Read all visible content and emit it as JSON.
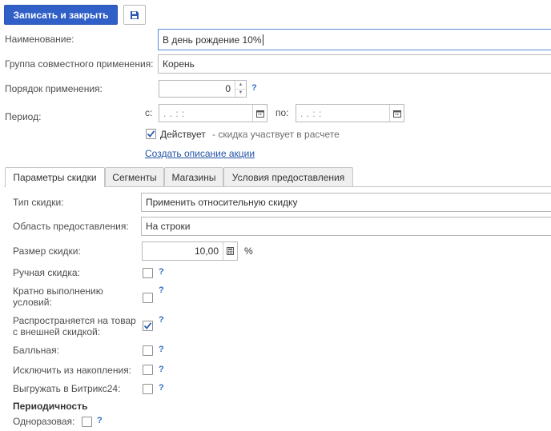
{
  "toolbar": {
    "save_close_label": "Записать и закрыть",
    "save_icon": "floppy-disk-icon"
  },
  "form": {
    "name_label": "Наименование:",
    "name_value": "В день рождение 10%",
    "group_label": "Группа совместного применения:",
    "group_value": "Корень",
    "order_label": "Порядок применения:",
    "order_value": "0",
    "period_label": "Период:",
    "period_from_label": "с:",
    "period_from_value": ".   .       :  :",
    "period_to_label": "по:",
    "period_to_value": ".   .       :  :",
    "active_label": "Действует",
    "active_checked": true,
    "active_hint": "- скидка участвует в расчете",
    "create_description_link": "Создать описание акции"
  },
  "tabs": [
    {
      "label": "Параметры скидки",
      "active": true
    },
    {
      "label": "Сегменты",
      "active": false
    },
    {
      "label": "Магазины",
      "active": false
    },
    {
      "label": "Условия предоставления",
      "active": false
    }
  ],
  "params": {
    "discount_type_label": "Тип скидки:",
    "discount_type_value": "Применить относительную скидку",
    "scope_label": "Область предоставления:",
    "scope_value": "На строки",
    "size_label": "Размер скидки:",
    "size_value": "10,00",
    "size_unit": "%",
    "manual_label": "Ручная скидка:",
    "manual_checked": false,
    "multiple_label": "Кратно выполнению условий:",
    "multiple_checked": false,
    "extends_label": "Распространяется на товар с внешней скидкой:",
    "extends_checked": true,
    "points_label": "Балльная:",
    "points_checked": false,
    "exclude_label": "Исключить из накопления:",
    "exclude_checked": false,
    "bitrix_label": "Выгружать в Битрикс24:",
    "bitrix_checked": false,
    "periodicity_title": "Периодичность",
    "one_time_label": "Одноразовая:",
    "one_time_checked": false,
    "help_mark": "?"
  },
  "colors": {
    "accent": "#2f5fc7",
    "link": "#2454a6",
    "help": "#2f6ec4",
    "check": "#2a5fb0"
  }
}
